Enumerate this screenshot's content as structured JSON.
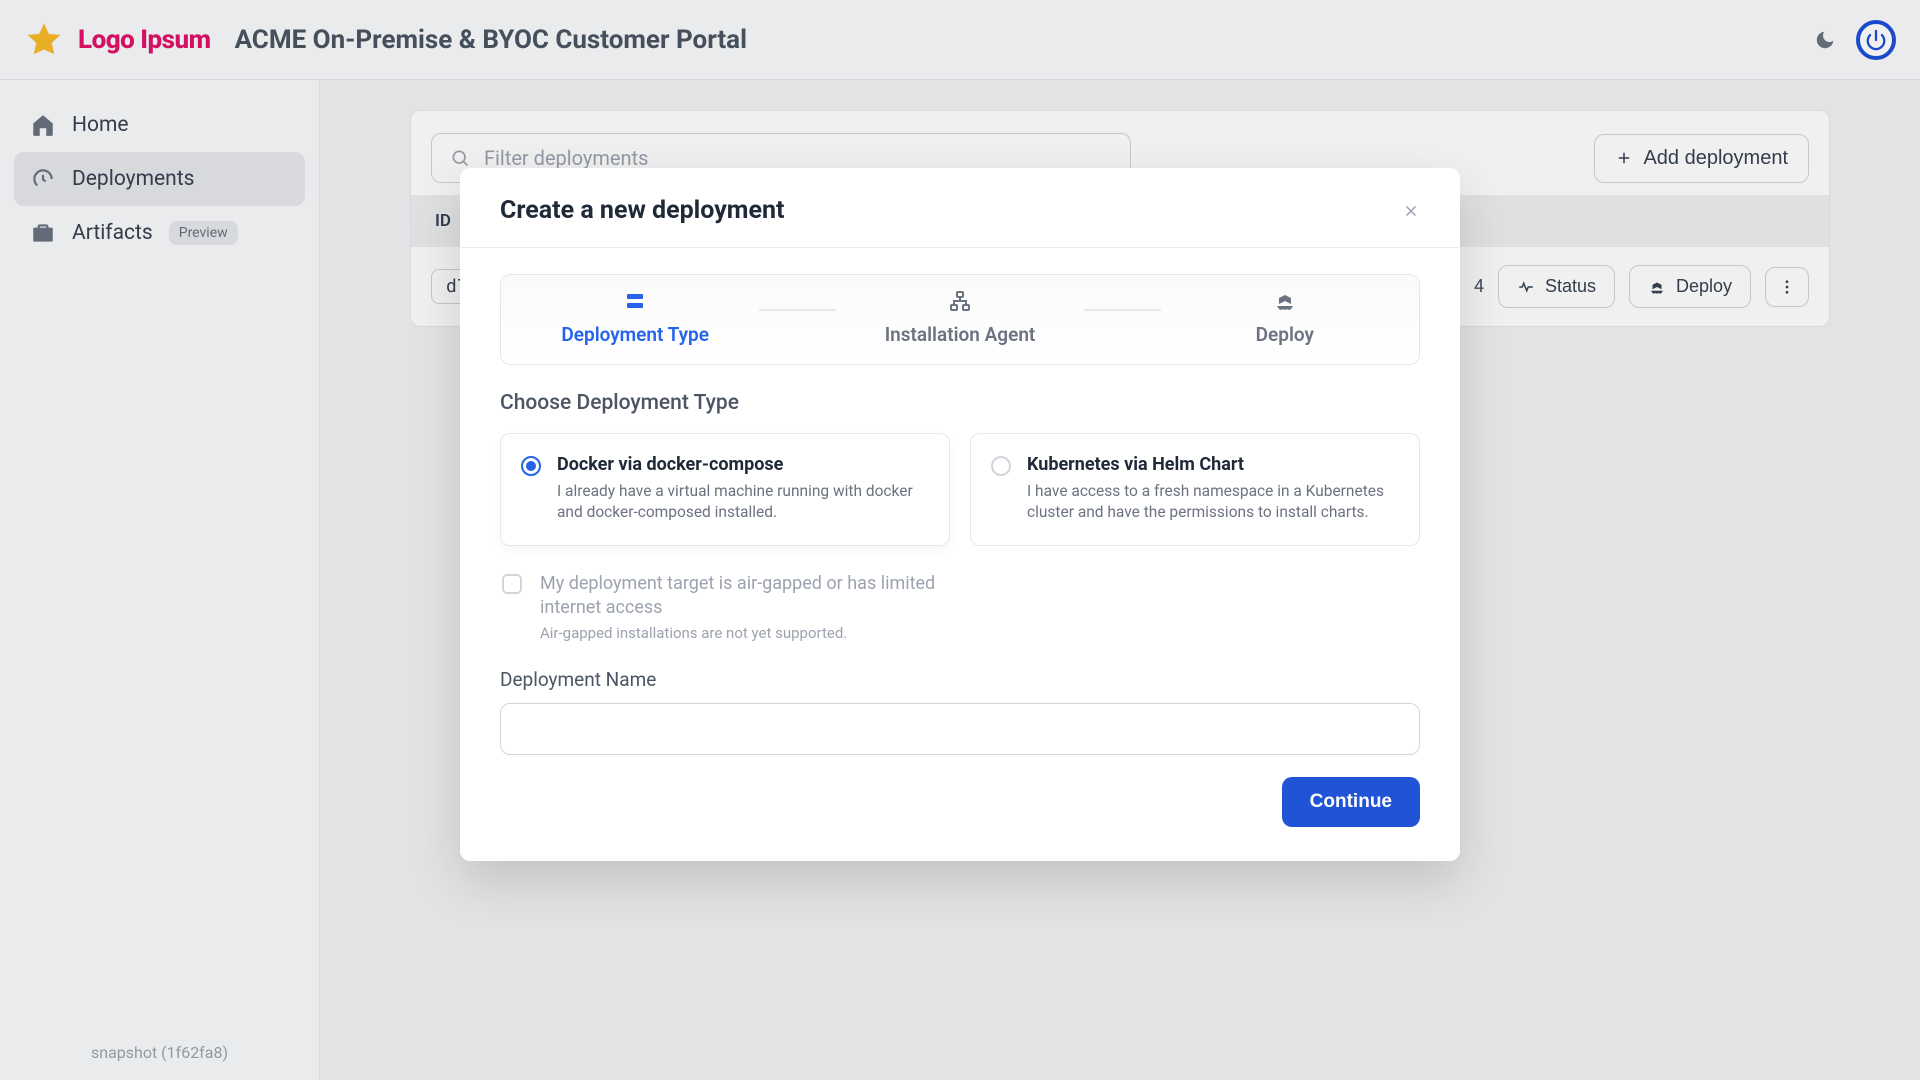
{
  "header": {
    "logo_text": "Logo Ipsum",
    "title": "ACME On-Premise & BYOC Customer Portal"
  },
  "sidebar": {
    "items": [
      {
        "label": "Home"
      },
      {
        "label": "Deployments"
      },
      {
        "label": "Artifacts",
        "badge": "Preview"
      }
    ],
    "version": "snapshot (1f62fa8)"
  },
  "toolbar": {
    "filter_placeholder": "Filter deployments",
    "add_button": "Add deployment"
  },
  "table": {
    "columns": {
      "id": "ID"
    },
    "rows": [
      {
        "id": "d7",
        "r_value": "4",
        "status_label": "Status",
        "deploy_label": "Deploy"
      }
    ]
  },
  "modal": {
    "title": "Create a new deployment",
    "steps": [
      {
        "label": "Deployment Type"
      },
      {
        "label": "Installation Agent"
      },
      {
        "label": "Deploy"
      }
    ],
    "section_label": "Choose Deployment Type",
    "options": [
      {
        "title": "Docker via docker-compose",
        "desc": "I already have a virtual machine running with docker and docker-composed installed."
      },
      {
        "title": "Kubernetes via Helm Chart",
        "desc": "I have access to a fresh namespace in a Kubernetes cluster and have the permissions to install charts."
      }
    ],
    "airgap": {
      "label": "My deployment target is air-gapped or has limited internet access",
      "sub": "Air-gapped installations are not yet supported."
    },
    "name_field_label": "Deployment Name",
    "continue_button": "Continue"
  }
}
